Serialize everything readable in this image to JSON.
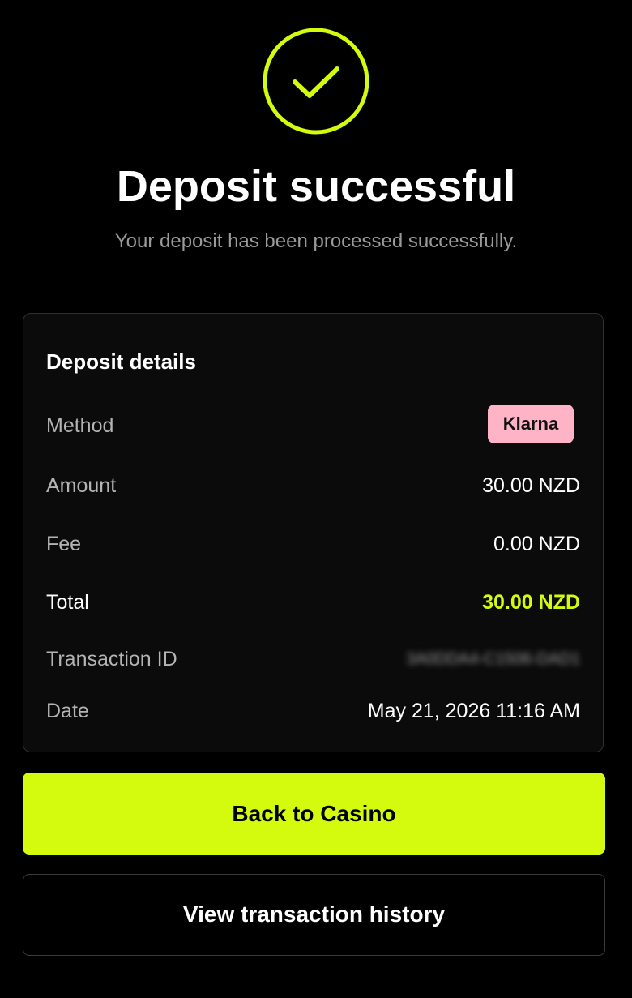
{
  "colors": {
    "accent": "#d4fa0d",
    "background": "#000000",
    "card_background": "#0b0b0b",
    "klarna_pink": "#ffb3c7"
  },
  "header": {
    "icon": "check-circle-icon",
    "title": "Deposit successful",
    "subtitle": "Your deposit has been processed successfully."
  },
  "details": {
    "title": "Deposit details",
    "method": {
      "label": "Method",
      "value": "Klarna"
    },
    "amount": {
      "label": "Amount",
      "value": "30.00 NZD"
    },
    "fee": {
      "label": "Fee",
      "value": "0.00 NZD"
    },
    "total": {
      "label": "Total",
      "value": "30.00 NZD"
    },
    "transaction_id": {
      "label": "Transaction ID",
      "value": "3A0DDA4-C1506-DAD1"
    },
    "date": {
      "label": "Date",
      "value": "May 21, 2026 11:16 AM"
    }
  },
  "actions": {
    "back_label": "Back to Casino",
    "history_label": "View transaction history"
  }
}
